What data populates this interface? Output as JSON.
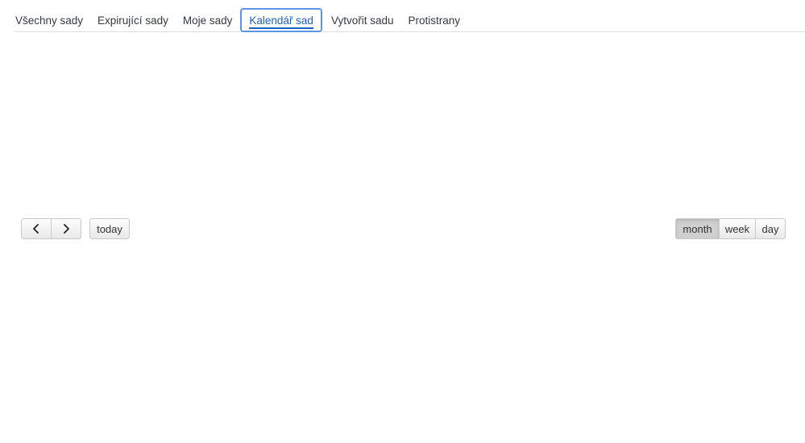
{
  "tabs": [
    {
      "label": "Všechny sady",
      "active": false
    },
    {
      "label": "Expirující sady",
      "active": false
    },
    {
      "label": "Moje sady",
      "active": false
    },
    {
      "label": "Kalendář sad",
      "active": true
    },
    {
      "label": "Vytvořit sadu",
      "active": false
    },
    {
      "label": "Protistrany",
      "active": false
    }
  ],
  "calendar": {
    "prev_icon": "chevron-left-icon",
    "next_icon": "chevron-right-icon",
    "today_label": "today",
    "views": {
      "month": "month",
      "week": "week",
      "day": "day",
      "active": "month"
    }
  },
  "colors": {
    "active_tab_text": "#1f5fbf",
    "active_tab_border": "#5b95e6",
    "active_view_bg": "#cfcfcf"
  }
}
